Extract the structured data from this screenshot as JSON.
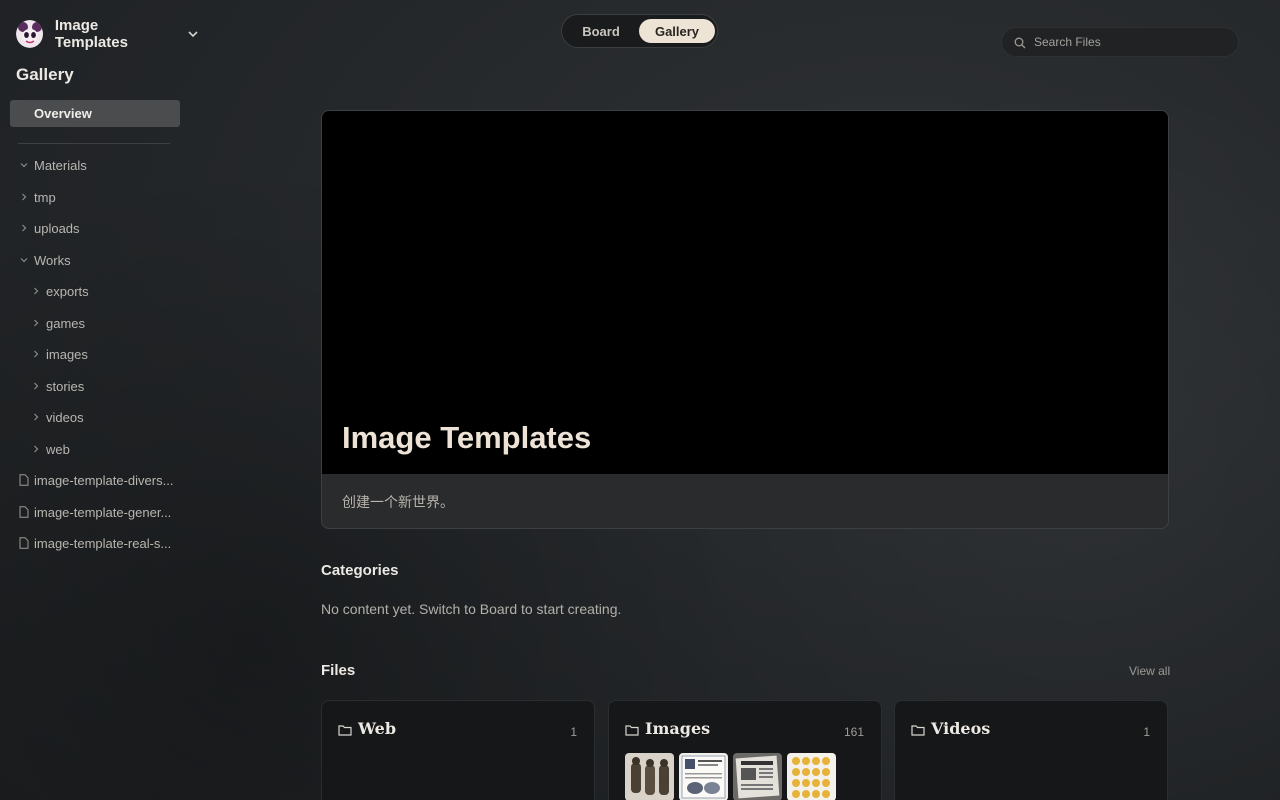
{
  "workspace": {
    "title": "Image Templates"
  },
  "sidebar": {
    "heading": "Gallery",
    "overview_label": "Overview",
    "tree": [
      {
        "label": "Materials",
        "kind": "folder",
        "expanded": true
      },
      {
        "label": "tmp",
        "kind": "folder",
        "expanded": false
      },
      {
        "label": "uploads",
        "kind": "folder",
        "expanded": false
      },
      {
        "label": "Works",
        "kind": "folder",
        "expanded": true
      },
      {
        "label": "exports",
        "kind": "folder",
        "expanded": false
      },
      {
        "label": "games",
        "kind": "folder",
        "expanded": false
      },
      {
        "label": "images",
        "kind": "folder",
        "expanded": false
      },
      {
        "label": "stories",
        "kind": "folder",
        "expanded": false
      },
      {
        "label": "videos",
        "kind": "folder",
        "expanded": false
      },
      {
        "label": "web",
        "kind": "folder",
        "expanded": false
      },
      {
        "label": "image-template-divers...",
        "kind": "file"
      },
      {
        "label": "image-template-gener...",
        "kind": "file"
      },
      {
        "label": "image-template-real-s...",
        "kind": "file"
      }
    ]
  },
  "view_toggle": {
    "board_label": "Board",
    "gallery_label": "Gallery",
    "active": "Gallery"
  },
  "search": {
    "placeholder": "Search Files"
  },
  "hero": {
    "title": "Image Templates",
    "subtitle": "创建一个新世界。"
  },
  "categories": {
    "title": "Categories",
    "empty_text": "No content yet. Switch to Board to start creating."
  },
  "files": {
    "title": "Files",
    "view_all_label": "View all",
    "cards": [
      {
        "name": "Web",
        "count": "1"
      },
      {
        "name": "Images",
        "count": "161"
      },
      {
        "name": "Videos",
        "count": "1"
      }
    ]
  },
  "colors": {
    "toggle_active_bg": "#eee4d6",
    "overview_bg": "#4a4c4e",
    "hero_cover": "#000000"
  },
  "icons": [
    "brand-logo-icon",
    "chevron-down-icon",
    "chevron-right-icon",
    "file-icon",
    "search-icon",
    "folder-icon"
  ]
}
